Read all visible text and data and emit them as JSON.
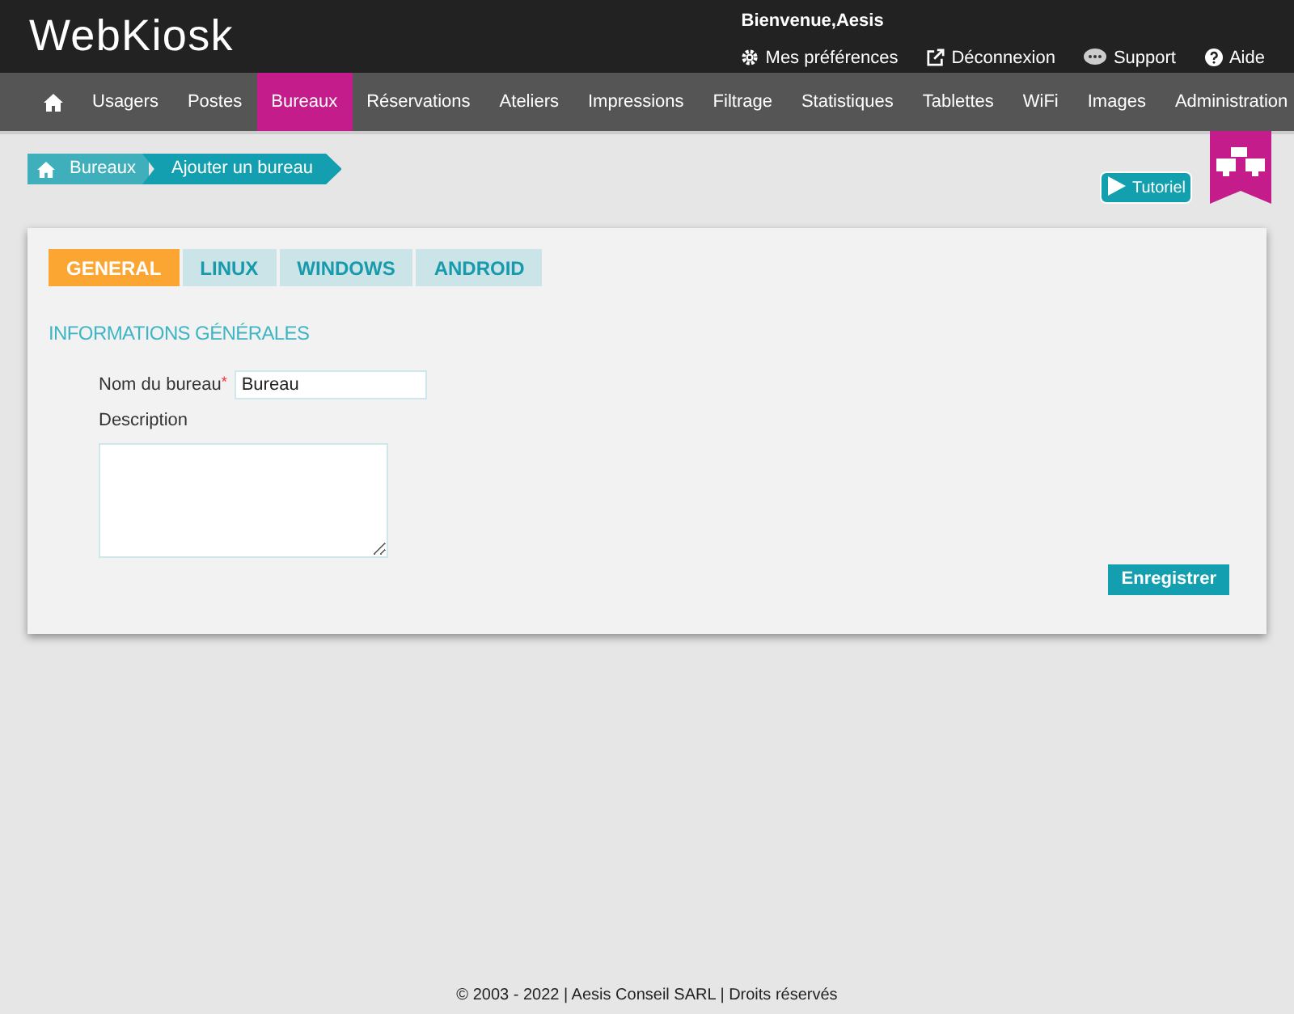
{
  "header": {
    "logo": "WebKiosk",
    "welcome": "Bienvenue,Aesis",
    "links": [
      {
        "kind": "gear",
        "label": "Mes préférences"
      },
      {
        "kind": "exit",
        "label": "Déconnexion"
      },
      {
        "kind": "chat",
        "label": "Support"
      },
      {
        "kind": "help",
        "label": "Aide"
      }
    ]
  },
  "nav": [
    {
      "label": "Usagers",
      "selected": false
    },
    {
      "label": "Postes",
      "selected": false
    },
    {
      "label": "Bureaux",
      "selected": true
    },
    {
      "label": "Réservations",
      "selected": false
    },
    {
      "label": "Ateliers",
      "selected": false
    },
    {
      "label": "Impressions",
      "selected": false
    },
    {
      "label": "Filtrage",
      "selected": false
    },
    {
      "label": "Statistiques",
      "selected": false
    },
    {
      "label": "Tablettes",
      "selected": false
    },
    {
      "label": "WiFi",
      "selected": false
    },
    {
      "label": "Images",
      "selected": false
    },
    {
      "label": "Administration",
      "selected": false
    }
  ],
  "breadcrumb": [
    "Bureaux",
    "Ajouter un bureau"
  ],
  "tutorial_button": "Tutoriel",
  "tabs": [
    {
      "label": "GENERAL",
      "selected": true
    },
    {
      "label": "LINUX",
      "selected": false
    },
    {
      "label": "WINDOWS",
      "selected": false
    },
    {
      "label": "ANDROID",
      "selected": false
    }
  ],
  "section_title": "INFORMATIONS GÉNÉRALES",
  "form": {
    "name_label": "Nom du bureau",
    "required_mark": "*",
    "name_value": "Bureau",
    "description_label": "Description"
  },
  "save_button": "Enregistrer",
  "footer": "© 2003 - 2022 | Aesis Conseil SARL | Droits réservés"
}
